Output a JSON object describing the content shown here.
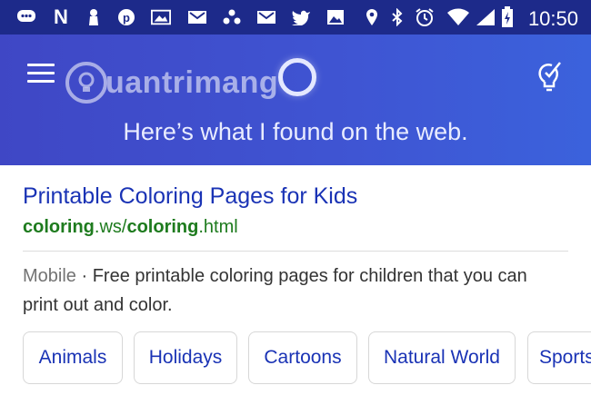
{
  "status_bar": {
    "time": "10:50",
    "icons": [
      "messages-icon",
      "netflix-icon",
      "keyhole-icon",
      "pinterest-icon",
      "gallery-icon",
      "gmail-icon",
      "dots-icon",
      "gmail-icon",
      "twitter-icon",
      "image-icon",
      "location-icon",
      "bluetooth-icon",
      "alarm-icon",
      "wifi-icon",
      "signal-icon",
      "battery-icon"
    ],
    "netflix_letter": "N"
  },
  "header": {
    "brand_text": "uantrimang",
    "brand_initial": "Q",
    "message": "Here’s what I found on the web."
  },
  "result": {
    "title": "Printable Coloring Pages for Kids",
    "url_part1": "coloring",
    "url_part2": ".ws/",
    "url_part3": "coloring",
    "url_part4": ".html",
    "snippet_meta": "Mobile",
    "snippet_sep": " · ",
    "snippet_text": "Free printable coloring pages for children that you can print out and color."
  },
  "chips": [
    {
      "label": "Animals"
    },
    {
      "label": "Holidays"
    },
    {
      "label": "Cartoons"
    },
    {
      "label": "Natural World"
    },
    {
      "label": "Sports"
    }
  ],
  "colors": {
    "status_bar": "#1d2a8a",
    "header": "#3f4fcf",
    "link": "#1a33b5",
    "url": "#1e7b1e"
  }
}
